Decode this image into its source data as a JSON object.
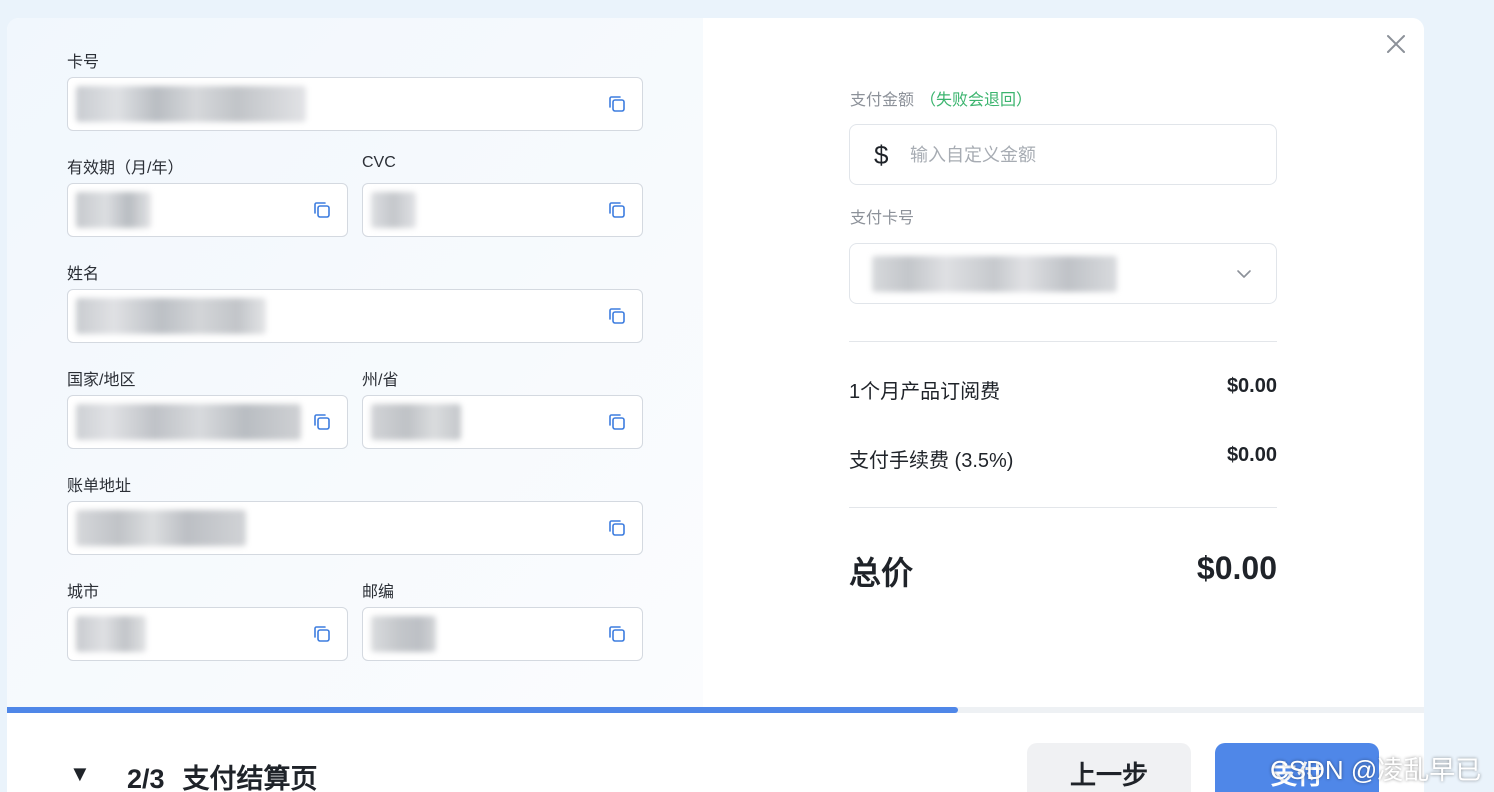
{
  "form": {
    "card_number_label": "卡号",
    "expiry_label": "有效期（月/年）",
    "cvc_label": "CVC",
    "name_label": "姓名",
    "country_label": "国家/地区",
    "state_label": "州/省",
    "billing_address_label": "账单地址",
    "city_label": "城市",
    "postal_code_label": "邮编"
  },
  "payment": {
    "amount_label": "支付金额",
    "amount_note": "（失败会退回）",
    "currency_symbol": "$",
    "amount_placeholder": "输入自定义金额",
    "card_label": "支付卡号"
  },
  "summary": {
    "items": [
      {
        "label": "1个月产品订阅费",
        "price": "$0.00"
      },
      {
        "label": "支付手续费 (3.5%)",
        "price": "$0.00"
      }
    ],
    "total_label": "总价",
    "total_value": "$0.00"
  },
  "progress": {
    "fraction": 0.671
  },
  "footer": {
    "step_toggle": "▼",
    "step_number": "2/3",
    "step_title": "支付结算页",
    "back_label": "上一步",
    "pay_label": "支付"
  },
  "watermark": "CSDN @凌乱早已",
  "colors": {
    "accent": "#4f87e8",
    "note_green": "#3bb46e"
  }
}
